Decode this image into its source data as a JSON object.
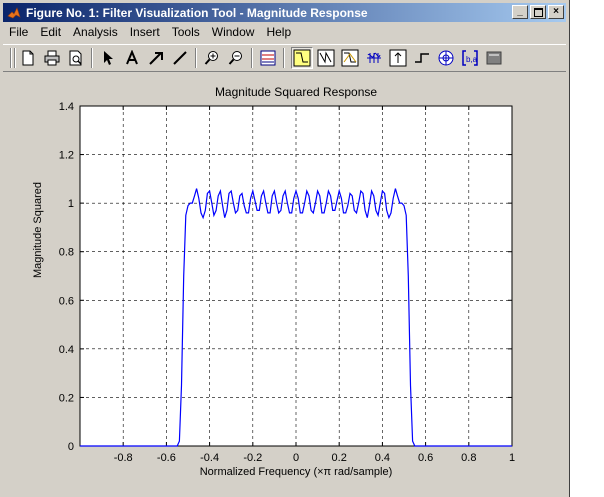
{
  "window": {
    "title": "Figure No. 1: Filter Visualization Tool - Magnitude Response",
    "controls": [
      "minimize",
      "maximize",
      "close"
    ]
  },
  "menubar": {
    "items": [
      "File",
      "Edit",
      "Analysis",
      "Insert",
      "Tools",
      "Window",
      "Help"
    ]
  },
  "toolbar": {
    "tools": [
      "new-icon",
      "print-icon",
      "print-preview-icon",
      "arrow-cursor-icon",
      "text-insert-icon",
      "arrow-insert-icon",
      "line-insert-icon",
      "zoom-in-icon",
      "zoom-out-icon",
      "filter-specs-icon",
      "magnitude-response-icon",
      "phase-response-icon",
      "mag-phase-icon",
      "group-delay-icon",
      "impulse-response-icon",
      "step-response-icon",
      "pole-zero-icon",
      "coefficients-icon",
      "filter-info-icon"
    ],
    "pressed": "magnitude-response-icon"
  },
  "chart_data": {
    "type": "line",
    "title": "Magnitude Squared Response",
    "xlabel": "Normalized Frequency  (×π rad/sample)",
    "ylabel": "Magnitude Squared",
    "xlim": [
      -1,
      1
    ],
    "ylim": [
      0,
      1.4
    ],
    "xticks": [
      -0.8,
      -0.6,
      -0.4,
      -0.2,
      0,
      0.2,
      0.4,
      0.6,
      0.8,
      1
    ],
    "yticks": [
      0,
      0.2,
      0.4,
      0.6,
      0.8,
      1,
      1.2,
      1.4
    ],
    "grid": true,
    "line_color": "#0000ff",
    "series": [
      {
        "x": [
          -1,
          -0.6,
          -0.55,
          -0.54,
          -0.53,
          -0.52,
          -0.51,
          -0.5,
          -0.49,
          -0.48,
          -0.47,
          -0.46,
          -0.45,
          -0.44,
          -0.43,
          -0.42,
          -0.41,
          -0.4,
          -0.39,
          -0.38,
          -0.37,
          -0.36,
          -0.35,
          -0.34,
          -0.33,
          -0.32,
          -0.31,
          -0.3,
          -0.29,
          -0.28,
          -0.27,
          -0.26,
          -0.25,
          -0.24,
          -0.23,
          -0.22,
          -0.21,
          -0.2,
          -0.19,
          -0.18,
          -0.17,
          -0.16,
          -0.15,
          -0.14,
          -0.13,
          -0.12,
          -0.11,
          -0.1,
          -0.09,
          -0.08,
          -0.07,
          -0.06,
          -0.05,
          -0.04,
          -0.03,
          -0.02,
          -0.01,
          0,
          0.01,
          0.02,
          0.03,
          0.04,
          0.05,
          0.06,
          0.07,
          0.08,
          0.09,
          0.1,
          0.11,
          0.12,
          0.13,
          0.14,
          0.15,
          0.16,
          0.17,
          0.18,
          0.19,
          0.2,
          0.21,
          0.22,
          0.23,
          0.24,
          0.25,
          0.26,
          0.27,
          0.28,
          0.29,
          0.3,
          0.31,
          0.32,
          0.33,
          0.34,
          0.35,
          0.36,
          0.37,
          0.38,
          0.39,
          0.4,
          0.41,
          0.42,
          0.43,
          0.44,
          0.45,
          0.46,
          0.47,
          0.48,
          0.49,
          0.5,
          0.51,
          0.52,
          0.53,
          0.54,
          0.55,
          0.6,
          1
        ],
        "y": [
          0,
          0,
          0,
          0.02,
          0.25,
          0.7,
          0.95,
          0.99,
          1.0,
          1.0,
          1.03,
          1.06,
          1.02,
          0.96,
          0.94,
          0.97,
          1.04,
          1.05,
          1.0,
          0.95,
          0.97,
          1.03,
          1.05,
          0.99,
          0.94,
          0.97,
          1.04,
          1.05,
          1.0,
          0.96,
          0.97,
          1.03,
          1.04,
          0.99,
          0.96,
          0.96,
          1.02,
          1.05,
          1.01,
          0.97,
          0.97,
          1.03,
          1.05,
          1.0,
          0.96,
          0.96,
          1.03,
          1.05,
          1.0,
          0.96,
          0.97,
          1.03,
          1.05,
          1.0,
          0.96,
          0.96,
          1.02,
          1.05,
          1.02,
          0.96,
          0.96,
          1.0,
          1.05,
          1.03,
          0.97,
          0.96,
          1.0,
          1.05,
          1.03,
          0.96,
          0.96,
          1.0,
          1.05,
          1.03,
          0.97,
          0.97,
          1.01,
          1.05,
          1.02,
          0.96,
          0.96,
          0.99,
          1.04,
          1.03,
          0.97,
          0.96,
          1.0,
          1.05,
          1.04,
          0.97,
          0.94,
          0.99,
          1.05,
          1.03,
          0.97,
          0.95,
          1.0,
          1.05,
          1.04,
          0.97,
          0.94,
          0.96,
          1.02,
          1.06,
          1.03,
          1.0,
          1.0,
          0.99,
          0.95,
          0.7,
          0.25,
          0.02,
          0,
          0,
          0
        ]
      }
    ]
  }
}
